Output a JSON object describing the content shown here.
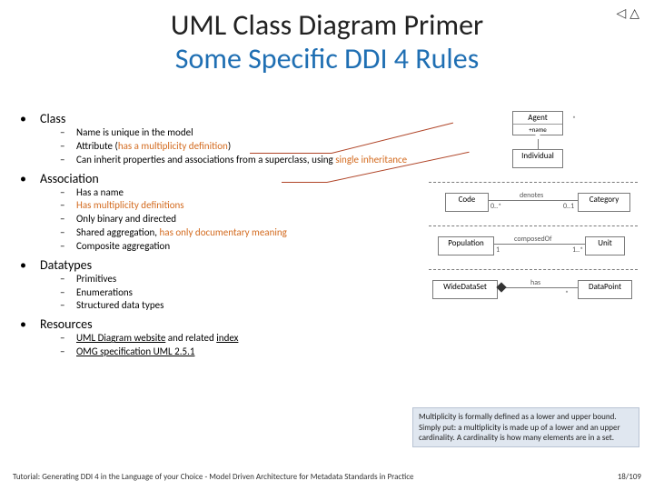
{
  "nav": {
    "icons": "◁△"
  },
  "title": {
    "line1": "UML Class Diagram Primer",
    "line2": "Some Specific DDI 4 Rules"
  },
  "sections": {
    "class": {
      "heading": "Class",
      "items": [
        {
          "pre": "Name is unique in the model"
        },
        {
          "pre": "Attribute (",
          "orange": "has a multiplicity definition",
          "post": ")"
        },
        {
          "pre": "Can inherit properties and associations from a superclass, using ",
          "orange": "single inheritance"
        }
      ]
    },
    "association": {
      "heading": "Association",
      "items": [
        {
          "pre": "Has a name"
        },
        {
          "orange": "Has multiplicity definitions"
        },
        {
          "pre": "Only binary and directed"
        },
        {
          "pre": "Shared aggregation, ",
          "orange": "has only documentary meaning"
        },
        {
          "pre": "Composite aggregation"
        }
      ]
    },
    "datatypes": {
      "heading": "Datatypes",
      "items": [
        {
          "pre": "Primitives"
        },
        {
          "pre": "Enumerations"
        },
        {
          "pre": "Structured data types"
        }
      ]
    },
    "resources": {
      "heading": "Resources",
      "items": [
        {
          "link1": "UML Diagram website",
          "mid": " and related ",
          "link2": "index"
        },
        {
          "link1": "OMG specification UML 2.5.1"
        }
      ]
    }
  },
  "diagram": {
    "agent": "Agent",
    "individual": "Individual",
    "code": "Code",
    "category": "Category",
    "population": "Population",
    "unit": "Unit",
    "wide": "WideDataSet",
    "datapoint": "DataPoint",
    "denotes": "denotes",
    "composedOf": "composedOf",
    "has": "has",
    "star": "*",
    "one": "1",
    "onestar": "1..*",
    "zerostar": "0..*",
    "zero1": "0..1",
    "attr1": "+name",
    "attr2": "…"
  },
  "tooltip": {
    "text": "Multiplicity is formally defined as a lower and upper bound. Simply put: a multiplicity is made up of a lower and an upper cardinality. A cardinality is how many elements are in a set."
  },
  "footer": {
    "left": "Tutorial: Generating DDI 4 in the Language of your Choice - Model Driven Architecture for Metadata Standards in Practice",
    "right": "18/109"
  }
}
